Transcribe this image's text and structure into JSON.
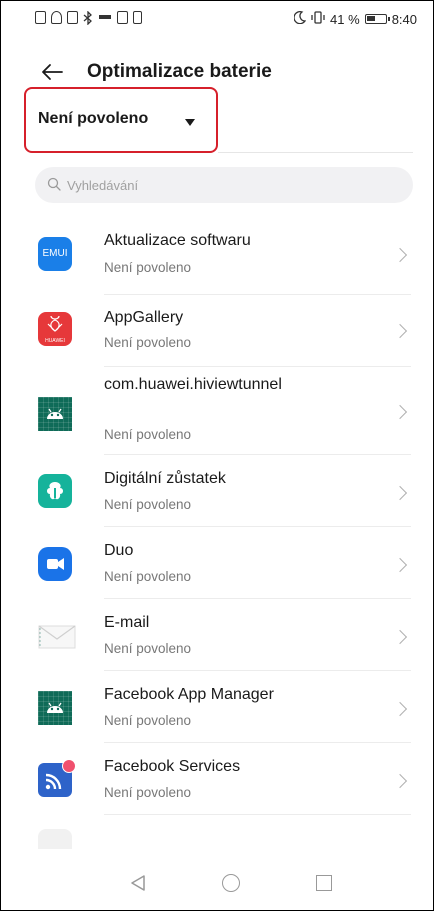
{
  "status_bar": {
    "battery_text": "41 %",
    "time": "8:40"
  },
  "header": {
    "title": "Optimalizace baterie"
  },
  "filter": {
    "selected": "Není povoleno"
  },
  "search": {
    "placeholder": "Vyhledávání"
  },
  "apps": [
    {
      "title": "Aktualizace softwaru",
      "status": "Není povoleno",
      "icon": "emui-icon"
    },
    {
      "title": "AppGallery",
      "status": "Není povoleno",
      "icon": "appgallery-icon"
    },
    {
      "title": "com.huawei.hiviewtunnel",
      "status": "Není povoleno",
      "icon": "android-icon"
    },
    {
      "title": "Digitální zůstatek",
      "status": "Není povoleno",
      "icon": "digital-balance-icon"
    },
    {
      "title": "Duo",
      "status": "Není povoleno",
      "icon": "duo-icon"
    },
    {
      "title": "E-mail",
      "status": "Není povoleno",
      "icon": "email-icon"
    },
    {
      "title": "Facebook App Manager",
      "status": "Není povoleno",
      "icon": "android-icon"
    },
    {
      "title": "Facebook Services",
      "status": "Není povoleno",
      "icon": "facebook-services-icon"
    }
  ],
  "icons": {
    "emui_text": "EMUI",
    "huawei_text": "HUAWEI"
  }
}
